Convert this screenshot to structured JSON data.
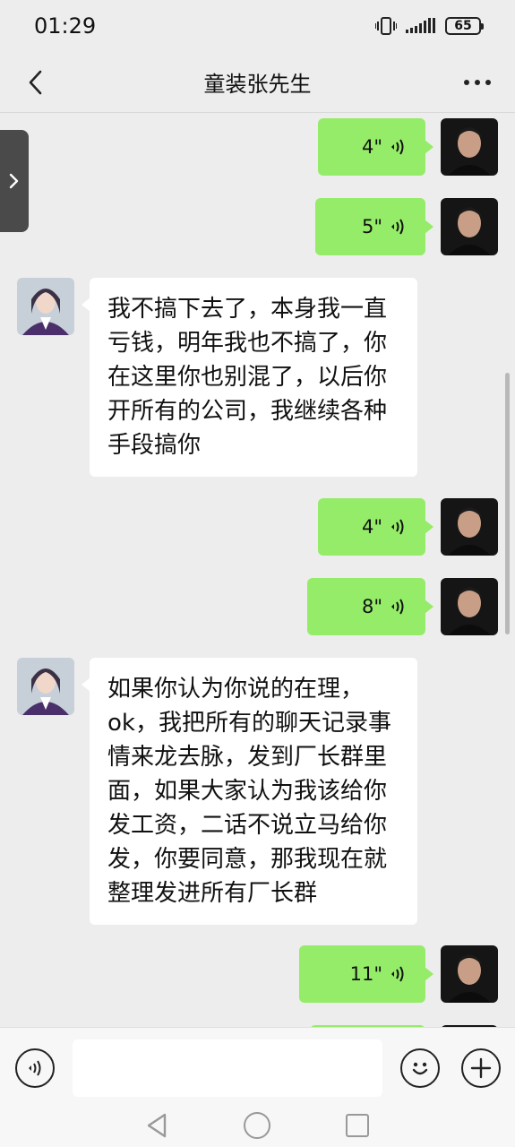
{
  "status": {
    "time": "01:29",
    "battery": "65"
  },
  "nav": {
    "title": "童装张先生"
  },
  "messages": [
    {
      "type": "voice",
      "side": "right",
      "duration": "4\""
    },
    {
      "type": "voice",
      "side": "right",
      "duration": "5\""
    },
    {
      "type": "text",
      "side": "left",
      "text": "我不搞下去了，本身我一直亏钱，明年我也不搞了，你在这里你也别混了，以后你开所有的公司，我继续各种手段搞你"
    },
    {
      "type": "voice",
      "side": "right",
      "duration": "4\""
    },
    {
      "type": "voice",
      "side": "right",
      "duration": "8\""
    },
    {
      "type": "text",
      "side": "left",
      "text": "如果你认为你说的在理，ok，我把所有的聊天记录事情来龙去脉，发到厂长群里面，如果大家认为我该给你发工资，二话不说立马给你发，你要同意，那我现在就整理发进所有厂长群"
    },
    {
      "type": "voice",
      "side": "right",
      "duration": "11\""
    }
  ],
  "input": {
    "placeholder": ""
  },
  "icons": {
    "back": "chevron-left-icon",
    "more": "more-dots-icon",
    "voice_toggle": "voice-mode-icon",
    "emoji": "emoji-icon",
    "add": "plus-icon"
  },
  "colors": {
    "sent_bubble": "#95ec69",
    "received_bubble": "#ffffff",
    "background": "#ededed"
  }
}
